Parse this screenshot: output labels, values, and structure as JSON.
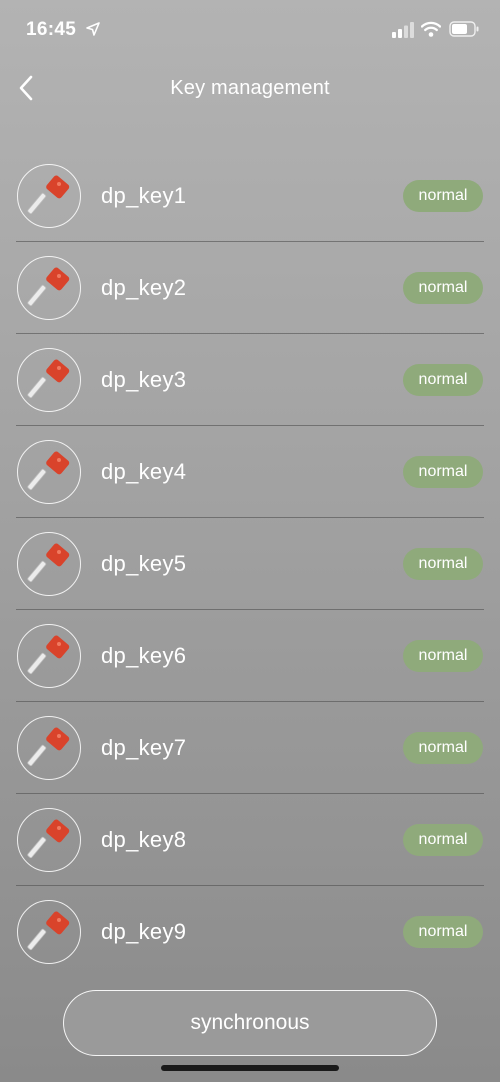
{
  "status_bar": {
    "time": "16:45"
  },
  "nav": {
    "title": "Key management"
  },
  "keys": [
    {
      "name": "dp_key1",
      "status": "normal"
    },
    {
      "name": "dp_key2",
      "status": "normal"
    },
    {
      "name": "dp_key3",
      "status": "normal"
    },
    {
      "name": "dp_key4",
      "status": "normal"
    },
    {
      "name": "dp_key5",
      "status": "normal"
    },
    {
      "name": "dp_key6",
      "status": "normal"
    },
    {
      "name": "dp_key7",
      "status": "normal"
    },
    {
      "name": "dp_key8",
      "status": "normal"
    },
    {
      "name": "dp_key9",
      "status": "normal"
    }
  ],
  "footer": {
    "sync_label": "synchronous"
  },
  "icons": {
    "back": "chevron-left-icon",
    "key": "key-icon",
    "location": "location-arrow-icon",
    "signal": "cellular-signal-icon",
    "wifi": "wifi-icon",
    "battery": "battery-icon"
  },
  "colors": {
    "badge": "#8faa7b",
    "key_head": "#d9432b",
    "background_top": "#b3b3b3",
    "background_bottom": "#8a8a8a"
  }
}
